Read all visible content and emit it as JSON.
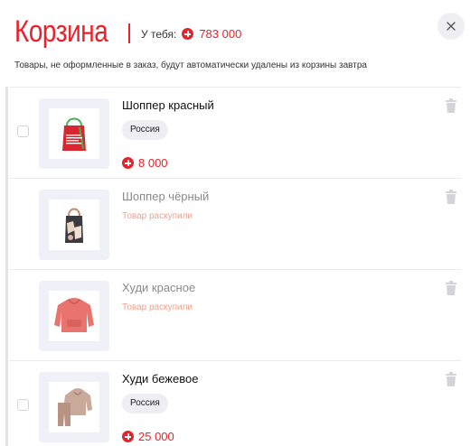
{
  "header": {
    "title": "Корзина",
    "balance_label": "У тебя:",
    "balance_value": "783 000",
    "close_icon": "close-icon"
  },
  "notice": "Товары, не оформленные в заказ, будут автоматически удалены из корзины завтра",
  "colors": {
    "accent": "#e8222a",
    "soldout": "#f2a08e",
    "thumb_bg": "#f0f0f8",
    "tag_bg": "#eeeef3"
  },
  "items": [
    {
      "name": "Шоппер красный",
      "tag": "Россия",
      "price": "8 000",
      "status": "available",
      "image": "red-tote-bag"
    },
    {
      "name": "Шоппер чёрный",
      "soldout": "Товар раскупили",
      "status": "sold-out",
      "image": "black-tote-bag"
    },
    {
      "name": "Худи красное",
      "soldout": "Товар раскупили",
      "status": "sold-out",
      "image": "red-hoodie"
    },
    {
      "name": "Худи бежевое",
      "tag": "Россия",
      "price": "25 000",
      "status": "available",
      "image": "beige-hoodie-set"
    }
  ]
}
